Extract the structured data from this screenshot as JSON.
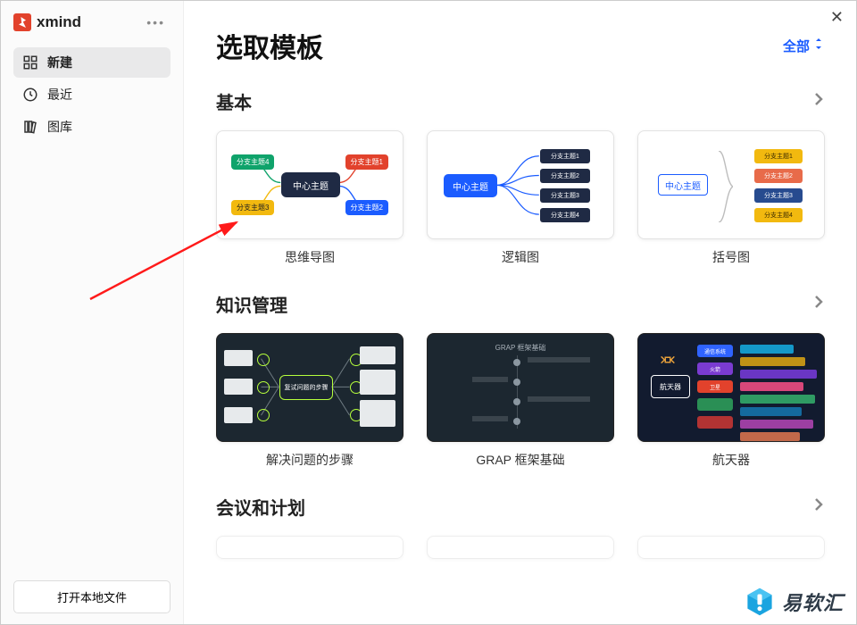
{
  "app": {
    "name": "xmind"
  },
  "sidebar": {
    "items": [
      {
        "label": "新建",
        "icon": "grid-icon"
      },
      {
        "label": "最近",
        "icon": "clock-icon"
      },
      {
        "label": "图库",
        "icon": "library-icon"
      }
    ],
    "open_local": "打开本地文件"
  },
  "header": {
    "title": "选取模板",
    "all": "全部"
  },
  "sections": [
    {
      "title": "基本",
      "cards": [
        {
          "label": "思维导图",
          "center": "中心主题",
          "branches": [
            "分支主题4",
            "分支主题1",
            "分支主题3",
            "分支主题2"
          ]
        },
        {
          "label": "逻辑图",
          "center": "中心主题",
          "rows": [
            "分支主题1",
            "分支主题2",
            "分支主题3",
            "分支主题4"
          ]
        },
        {
          "label": "括号图",
          "center": "中心主题",
          "rows": [
            "分支主题1",
            "分支主题2",
            "分支主题3",
            "分支主题4"
          ],
          "row_colors": [
            "#f2b90f",
            "#e86b4a",
            "#274b8f",
            "#f2b90f"
          ]
        }
      ]
    },
    {
      "title": "知识管理",
      "cards": [
        {
          "label": "解决问题的步骤",
          "center": "复试问题的步骤",
          "dark": true
        },
        {
          "label": "GRAP 框架基础",
          "title_in": "GRAP 框架基础",
          "dark": true
        },
        {
          "label": "航天器",
          "center": "航天器",
          "pills": [
            "通信系统",
            "火箭",
            "卫星"
          ],
          "pill_colors": [
            "#2f63ff",
            "#7a3bd1",
            "#e2422c"
          ],
          "bar_colors": [
            "#1498c9",
            "#c09216",
            "#6a36c4",
            "#d8477a",
            "#2f9b63",
            "#146a9e",
            "#9c3fa2",
            "#c2694a"
          ],
          "dark": true
        }
      ]
    },
    {
      "title": "会议和计划",
      "cards": []
    }
  ],
  "watermark": {
    "text": "易软汇"
  }
}
